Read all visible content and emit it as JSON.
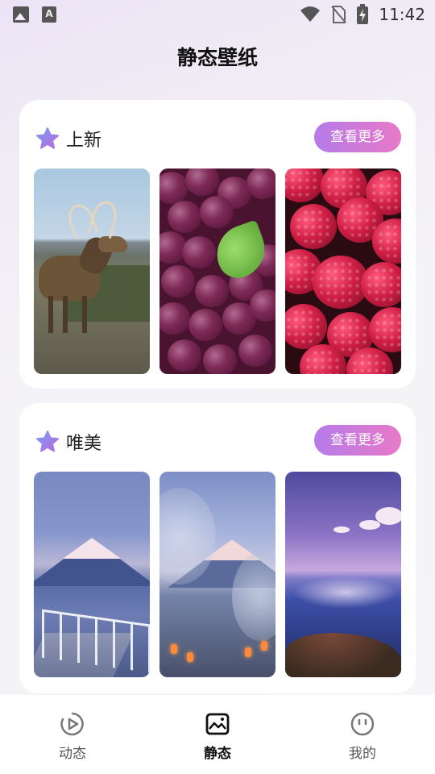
{
  "status_bar": {
    "left_icons": [
      "image-icon",
      "a-letter-icon"
    ],
    "right_icons": [
      "wifi-icon",
      "no-sim-icon",
      "battery-charging-icon"
    ],
    "time": "11:42"
  },
  "page": {
    "title": "静态壁纸"
  },
  "sections": [
    {
      "title": "上新",
      "icon": "star-icon",
      "more_label": "查看更多",
      "wallpapers": [
        "deer",
        "grapes",
        "raspberries"
      ]
    },
    {
      "title": "唯美",
      "icon": "star-icon",
      "more_label": "查看更多",
      "wallpapers": [
        "mount-fuji-pier",
        "mount-fuji-trees",
        "sea-sunset"
      ]
    }
  ],
  "bottom_nav": [
    {
      "label": "动态",
      "icon": "play-circle-icon",
      "active": false
    },
    {
      "label": "静态",
      "icon": "picture-icon",
      "active": true
    },
    {
      "label": "我的",
      "icon": "face-icon",
      "active": false
    }
  ],
  "colors": {
    "accent_start": "#b57be8",
    "accent_end": "#e879c8",
    "star": "#9b6fe6"
  }
}
